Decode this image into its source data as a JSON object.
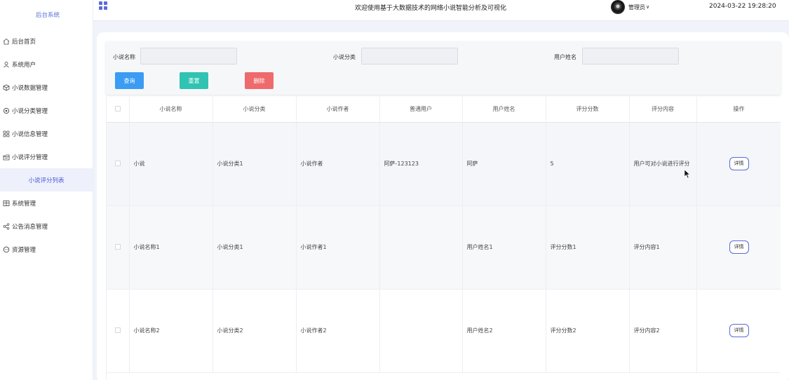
{
  "sidebar": {
    "brand": "后台系统",
    "items": [
      {
        "label": "后台首页",
        "icon": "home-icon"
      },
      {
        "label": "系统用户",
        "icon": "user-icon"
      },
      {
        "label": "小说数据管理",
        "icon": "cube-icon"
      },
      {
        "label": "小说分类管理",
        "icon": "settings-icon"
      },
      {
        "label": "小说信息管理",
        "icon": "grid-icon"
      },
      {
        "label": "小说评分管理",
        "icon": "folder-icon"
      },
      {
        "label": "系统管理",
        "icon": "table-icon"
      },
      {
        "label": "公告消息管理",
        "icon": "share-icon"
      },
      {
        "label": "资源管理",
        "icon": "chat-icon"
      }
    ],
    "active_sub": "小说评分列表"
  },
  "header": {
    "title": "欢迎使用基于大数据技术的网络小说智能分析及可视化",
    "user": "管理员",
    "datetime": "2024-03-22 19:28:20"
  },
  "search": {
    "name_label": "小说名称",
    "category_label": "小说分类",
    "username_label": "用户姓名",
    "name_value": "",
    "category_value": "",
    "username_value": "",
    "query_button": "查询",
    "reset_button": "重置",
    "delete_button": "删除"
  },
  "table": {
    "headers": [
      "小说名称",
      "小说分类",
      "小说作者",
      "普通用户",
      "用户姓名",
      "评分分数",
      "评分内容",
      "操作"
    ],
    "rows": [
      [
        "小说",
        "小说分类1",
        "小说作者",
        "阿萨-123123",
        "阿萨",
        "5",
        "用户可对小说进行评分"
      ],
      [
        "小说名称1",
        "小说分类1",
        "小说作者1",
        "",
        "用户姓名1",
        "评分分数1",
        "评分内容1"
      ],
      [
        "小说名称2",
        "小说分类2",
        "小说作者2",
        "",
        "用户姓名2",
        "评分分数2",
        "评分内容2"
      ]
    ],
    "detail_label": "详情"
  },
  "colors": {
    "accent": "#5a6bd9",
    "query": "#3b9cf3",
    "reset": "#31c3b2",
    "delete": "#ef6a6c"
  }
}
